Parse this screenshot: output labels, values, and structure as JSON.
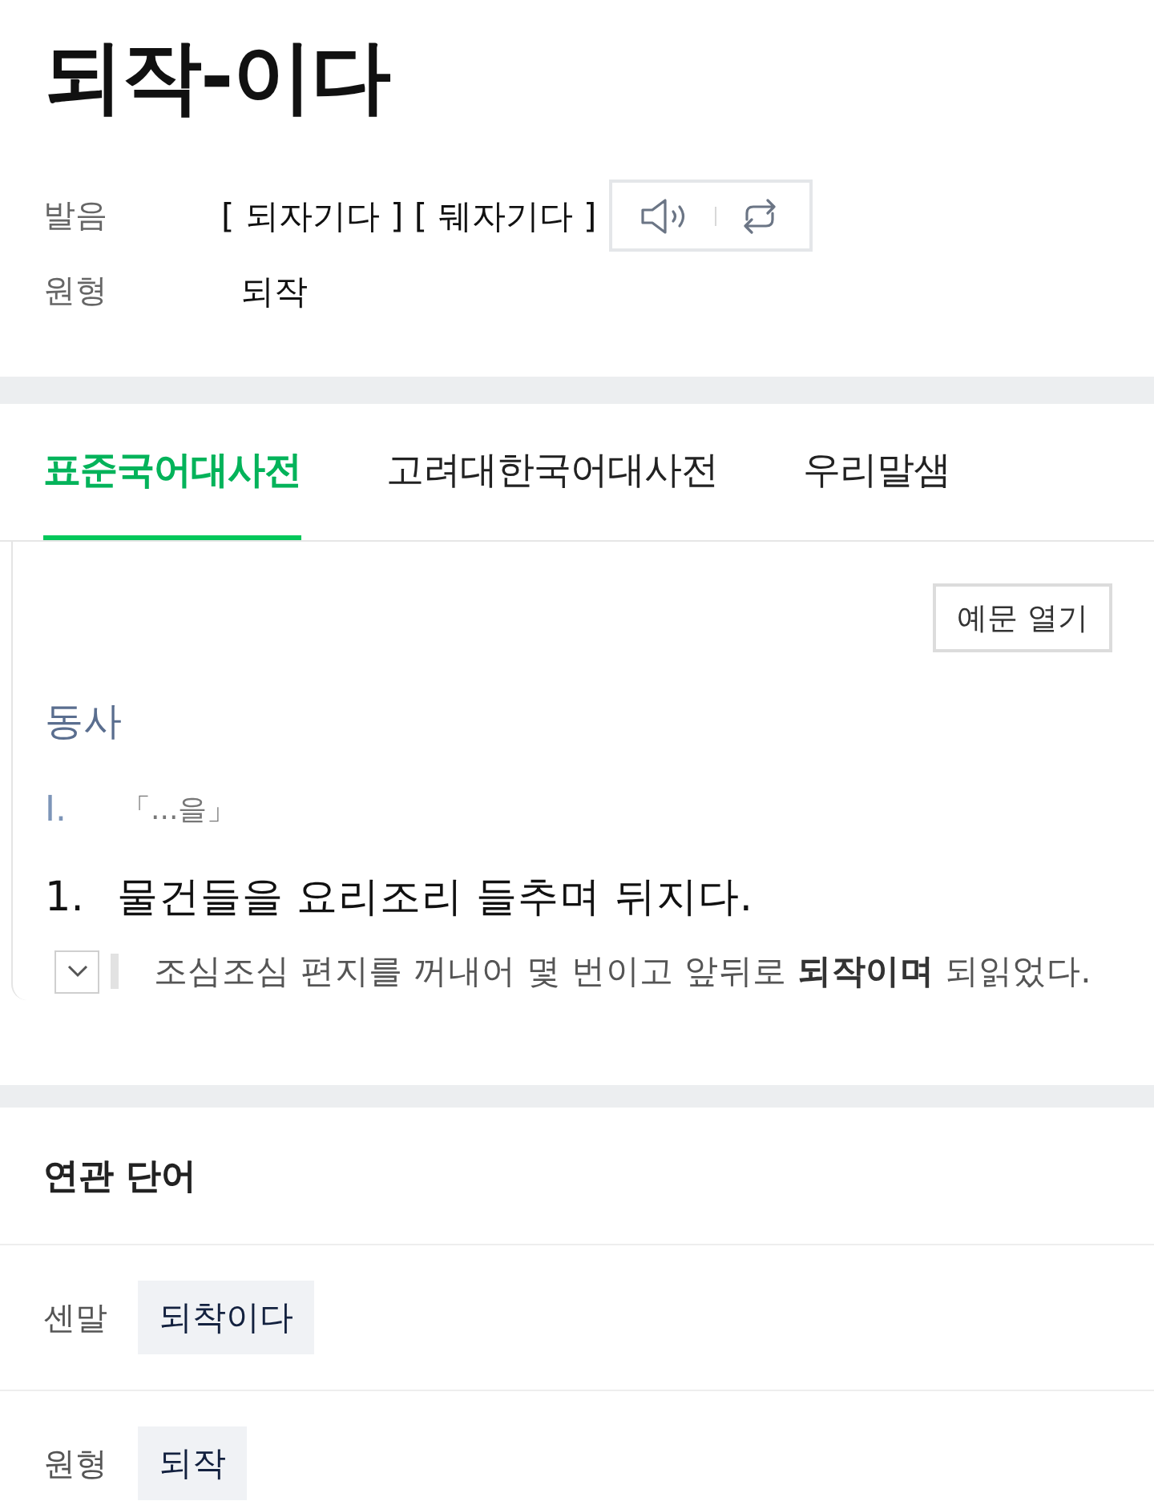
{
  "headword": "되작-이다",
  "info": [
    {
      "label": "발음",
      "value": "[ 되자기다 ] [ 뒈자기다 ]",
      "kind": "pronunciation"
    },
    {
      "label": "원형",
      "value": "되작",
      "kind": "text"
    }
  ],
  "tabs": [
    {
      "label": "표준국어대사전",
      "selected": true
    },
    {
      "label": "고려대한국어대사전",
      "selected": false
    },
    {
      "label": "우리말샘",
      "selected": false
    }
  ],
  "definitions": {
    "button": "예문 열기",
    "part_of_speech": "동사",
    "pattern": {
      "number": "I.",
      "text": "「...을」"
    },
    "senses": [
      {
        "number": "1.",
        "text": "물건들을 요리조리 들추며 뒤지다.",
        "example": {
          "expanded": false,
          "text": "조심조심 편지를 꺼내어 몇 번이고 앞뒤로 **되작이며** 되읽었다."
        }
      }
    ]
  },
  "related": {
    "title": "연관 단어",
    "rows": [
      {
        "label": "센말",
        "words": [
          "되착이다"
        ]
      },
      {
        "label": "원형",
        "words": [
          "되작"
        ]
      }
    ]
  }
}
